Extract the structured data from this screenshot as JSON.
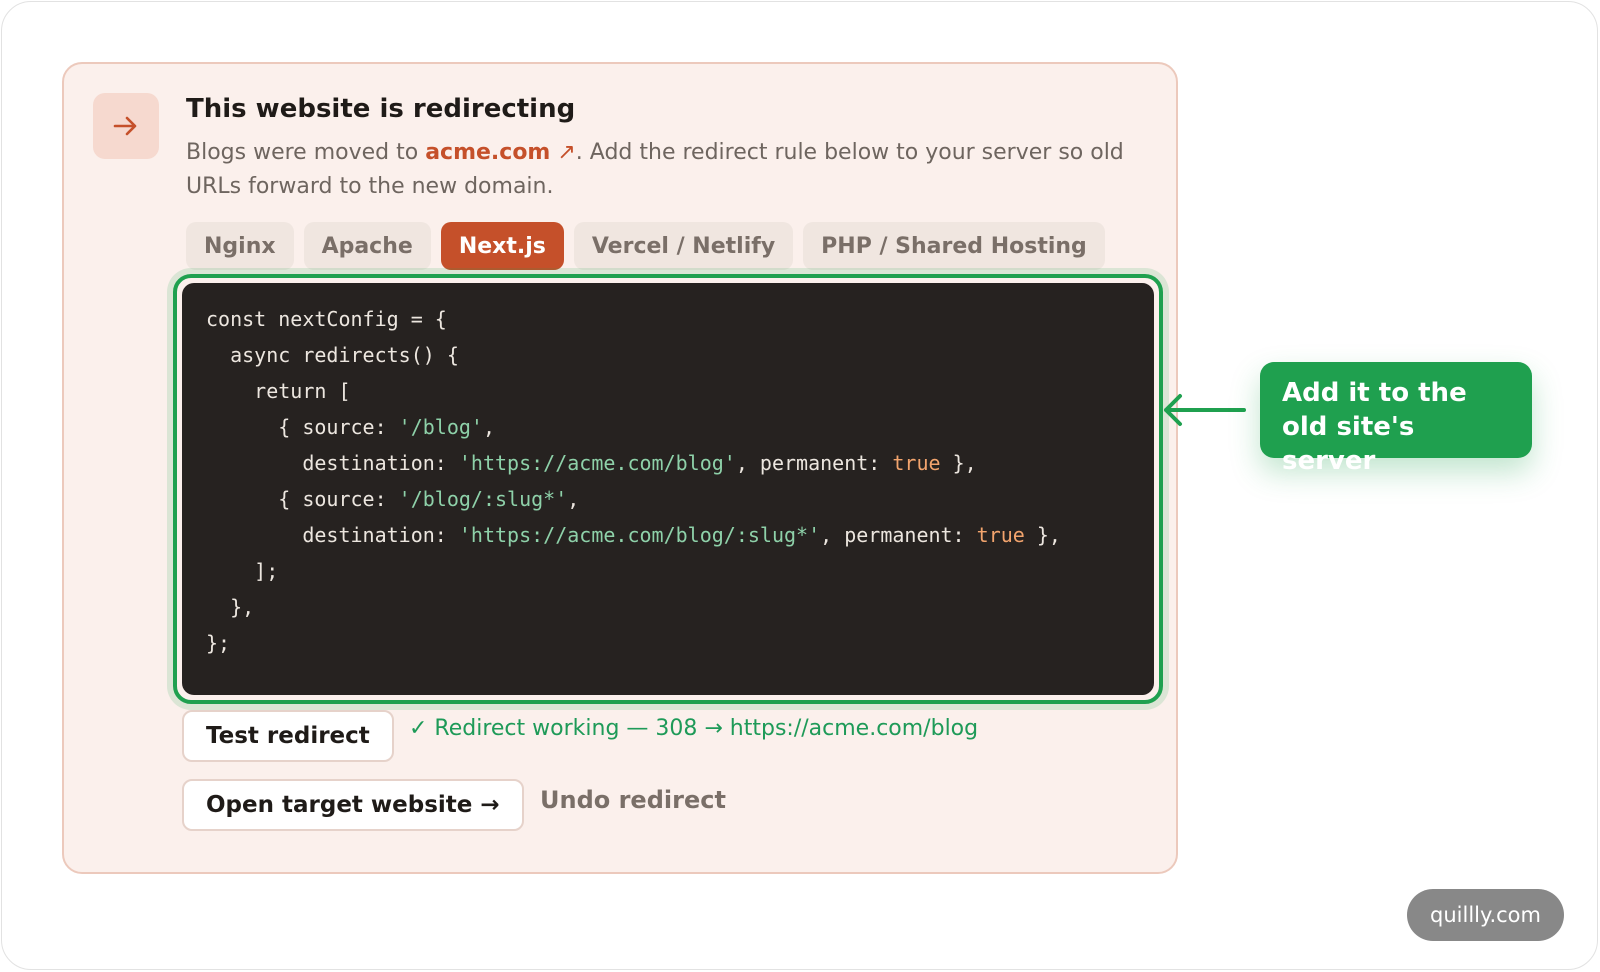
{
  "panel": {
    "title": "This website is redirecting",
    "desc_before": "Blogs were moved to ",
    "domain": "acme.com",
    "domain_ext": " ↗",
    "desc_after": ". Add the redirect rule below to your server so old URLs forward to the new domain."
  },
  "tabs": [
    {
      "label": "Nginx",
      "active": false
    },
    {
      "label": "Apache",
      "active": false
    },
    {
      "label": "Next.js",
      "active": true
    },
    {
      "label": "Vercel / Netlify",
      "active": false
    },
    {
      "label": "PHP / Shared Hosting",
      "active": false
    }
  ],
  "code": {
    "l1": "const nextConfig = {",
    "l2": "  async redirects() {",
    "l3": "    return [",
    "l4a": "      { source: ",
    "l4s": "'/blog'",
    "l4b": ",",
    "l5a": "        destination: ",
    "l5s": "'https://acme.com/blog'",
    "l5b": ", permanent: ",
    "l5k": "true",
    "l5c": " },",
    "l6a": "      { source: ",
    "l6s": "'/blog/:slug*'",
    "l6b": ",",
    "l7a": "        destination: ",
    "l7s": "'https://acme.com/blog/:slug*'",
    "l7b": ", permanent: ",
    "l7k": "true",
    "l7c": " },",
    "l8": "    ];",
    "l9": "  },",
    "l10": "};"
  },
  "actions": {
    "test_label": "Test redirect",
    "status": "✓ Redirect working — 308 → https://acme.com/blog",
    "open_label": "Open target website →",
    "undo_label": "Undo redirect"
  },
  "callout": {
    "line1": "Add it to the",
    "line2": "old site's server"
  },
  "watermark": "quillly.com",
  "colors": {
    "accent": "#c5502a",
    "highlight": "#1fa04f",
    "success_text": "#1e9a58",
    "code_bg": "#262220"
  }
}
